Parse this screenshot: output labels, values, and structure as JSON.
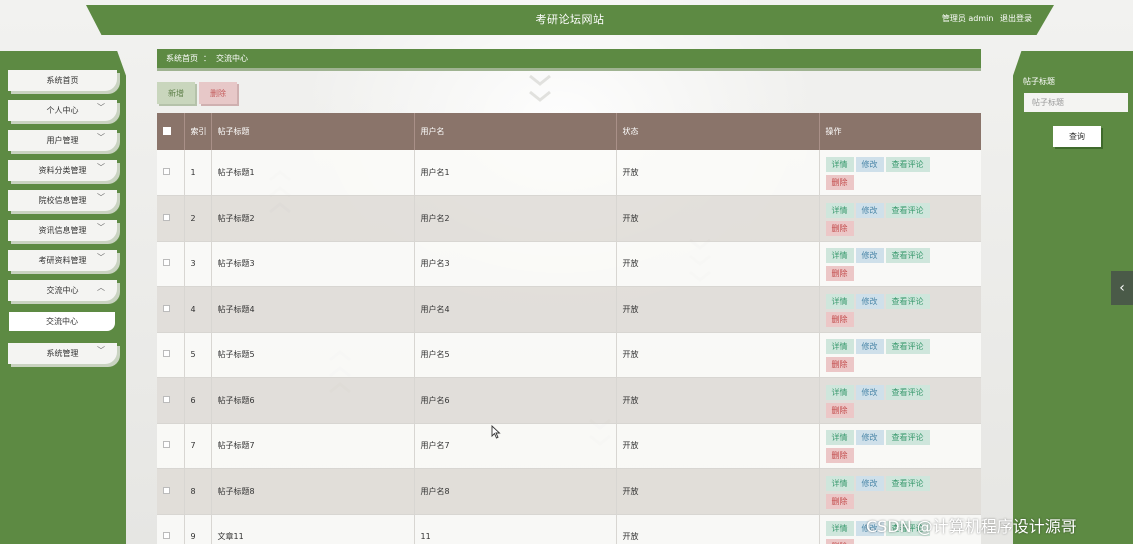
{
  "header": {
    "site_title": "考研论坛网站",
    "user_text": "管理员 admin",
    "logout": "退出登录"
  },
  "sidebar": {
    "items": [
      {
        "label": "系统首页",
        "chevron": ""
      },
      {
        "label": "个人中心",
        "chevron": "down"
      },
      {
        "label": "用户管理",
        "chevron": "down"
      },
      {
        "label": "资料分类管理",
        "chevron": "down"
      },
      {
        "label": "院校信息管理",
        "chevron": "down"
      },
      {
        "label": "资讯信息管理",
        "chevron": "down"
      },
      {
        "label": "考研资料管理",
        "chevron": "down"
      },
      {
        "label": "交流中心",
        "chevron": "up"
      },
      {
        "label": "系统管理",
        "chevron": "down"
      }
    ],
    "sub_items": [
      {
        "label": "交流中心"
      }
    ]
  },
  "breadcrumb": {
    "home": "系统首页",
    "separator": "：",
    "current": "交流中心"
  },
  "actions": {
    "add": "新增",
    "delete": "删除"
  },
  "table": {
    "headers": {
      "index": "索引",
      "title": "帖子标题",
      "username": "用户名",
      "status": "状态",
      "ops": "操作"
    },
    "op_labels": {
      "detail": "详情",
      "edit": "修改",
      "comments": "查看评论",
      "delete": "删除"
    },
    "rows": [
      {
        "index": "1",
        "title": "帖子标题1",
        "username": "用户名1",
        "status": "开放"
      },
      {
        "index": "2",
        "title": "帖子标题2",
        "username": "用户名2",
        "status": "开放"
      },
      {
        "index": "3",
        "title": "帖子标题3",
        "username": "用户名3",
        "status": "开放"
      },
      {
        "index": "4",
        "title": "帖子标题4",
        "username": "用户名4",
        "status": "开放"
      },
      {
        "index": "5",
        "title": "帖子标题5",
        "username": "用户名5",
        "status": "开放"
      },
      {
        "index": "6",
        "title": "帖子标题6",
        "username": "用户名6",
        "status": "开放"
      },
      {
        "index": "7",
        "title": "帖子标题7",
        "username": "用户名7",
        "status": "开放"
      },
      {
        "index": "8",
        "title": "帖子标题8",
        "username": "用户名8",
        "status": "开放"
      },
      {
        "index": "9",
        "title": "文章11",
        "username": "11",
        "status": "开放"
      }
    ]
  },
  "search_panel": {
    "label": "帖子标题",
    "placeholder": "帖子标题",
    "button": "查询"
  },
  "watermark": "CSDN @计算机程序设计源哥",
  "colors": {
    "primary_green": "#5d8a43",
    "table_header": "#8a746a",
    "detail_green": "#3a9a6e",
    "edit_blue": "#4a86a8",
    "delete_red": "#c24a4a"
  }
}
